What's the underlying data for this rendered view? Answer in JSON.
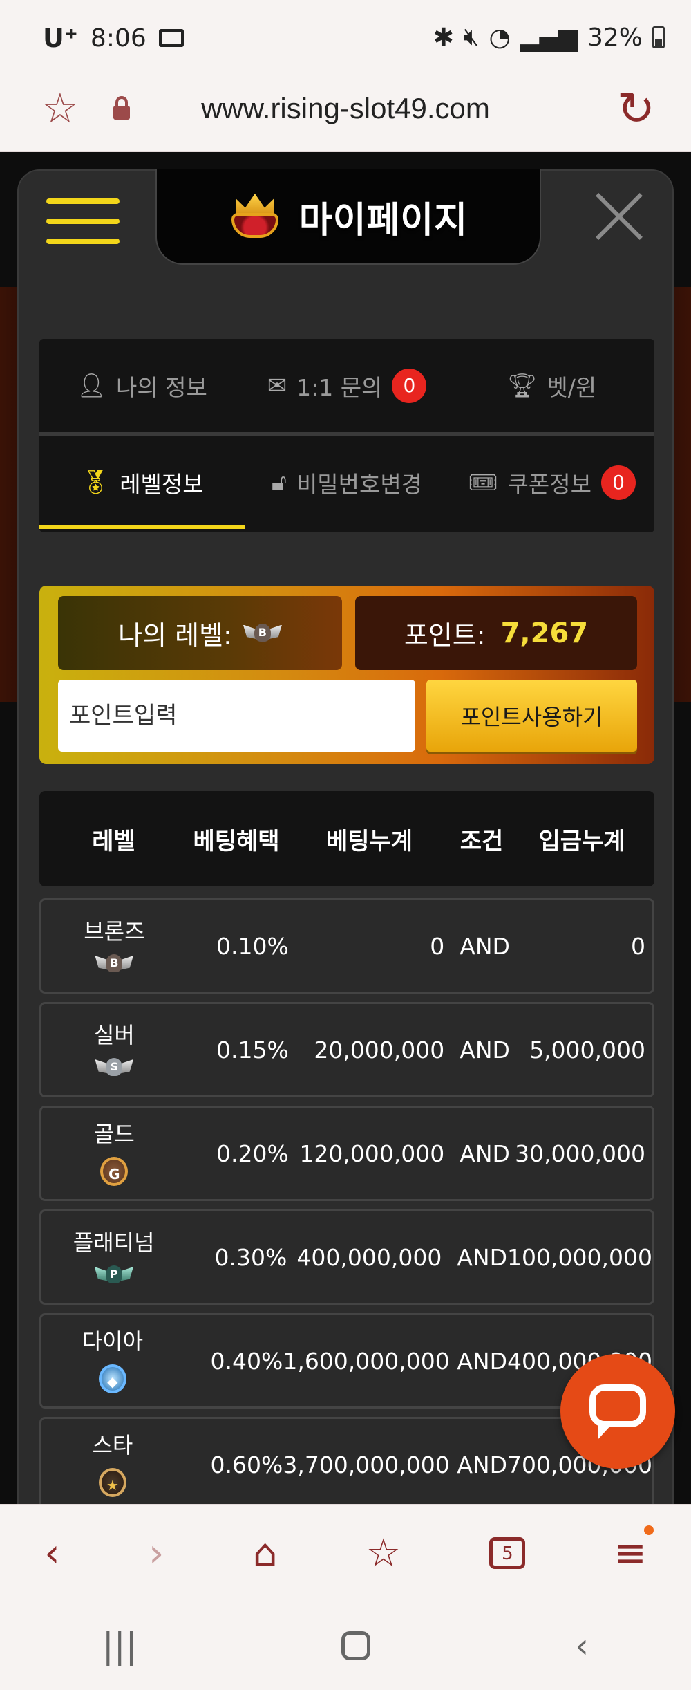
{
  "status_bar": {
    "carrier": "U⁺",
    "time": "8:06",
    "battery": "32%"
  },
  "browser": {
    "url": "www.rising-slot49.com"
  },
  "modal": {
    "title": "마이페이지",
    "tabs_row1": [
      {
        "label": "나의 정보",
        "icon": "person-icon"
      },
      {
        "label": "1:1 문의",
        "icon": "mail-icon",
        "badge": "0"
      },
      {
        "label": "벳/윈",
        "icon": "trophy-icon"
      }
    ],
    "tabs_row2": [
      {
        "label": "레벨정보",
        "icon": "medal-icon",
        "active": true
      },
      {
        "label": "비밀번호변경",
        "icon": "unlock-icon"
      },
      {
        "label": "쿠폰정보",
        "icon": "ticket-icon",
        "badge": "0"
      }
    ]
  },
  "level_panel": {
    "my_level_label": "나의 레벨:",
    "my_level_emblem": "B",
    "points_label": "포인트:",
    "points_value": "7,267",
    "point_input_placeholder": "포인트입력",
    "use_points_button": "포인트사용하기"
  },
  "table": {
    "headers": [
      "레벨",
      "베팅혜택",
      "베팅누계",
      "조건",
      "입금누계"
    ],
    "rows": [
      {
        "level": "브론즈",
        "emblem": "B",
        "benefit": "0.10%",
        "bet_total": "0",
        "cond": "AND",
        "deposit_total": "0"
      },
      {
        "level": "실버",
        "emblem": "S",
        "benefit": "0.15%",
        "bet_total": "20,000,000",
        "cond": "AND",
        "deposit_total": "5,000,000"
      },
      {
        "level": "골드",
        "emblem": "G",
        "benefit": "0.20%",
        "bet_total": "120,000,000",
        "cond": "AND",
        "deposit_total": "30,000,000"
      },
      {
        "level": "플래티넘",
        "emblem": "P",
        "benefit": "0.30%",
        "bet_total": "400,000,000",
        "cond": "AND",
        "deposit_total": "100,000,000"
      },
      {
        "level": "다이아",
        "emblem": "◆",
        "benefit": "0.40%",
        "bet_total": "1,600,000,000",
        "cond": "AND",
        "deposit_total": "400,000,000"
      },
      {
        "level": "스타",
        "emblem": "★",
        "benefit": "0.60%",
        "bet_total": "3,700,000,000",
        "cond": "AND",
        "deposit_total": "700,000,000"
      }
    ]
  },
  "bottom_nav": {
    "tabs_count": "5"
  }
}
